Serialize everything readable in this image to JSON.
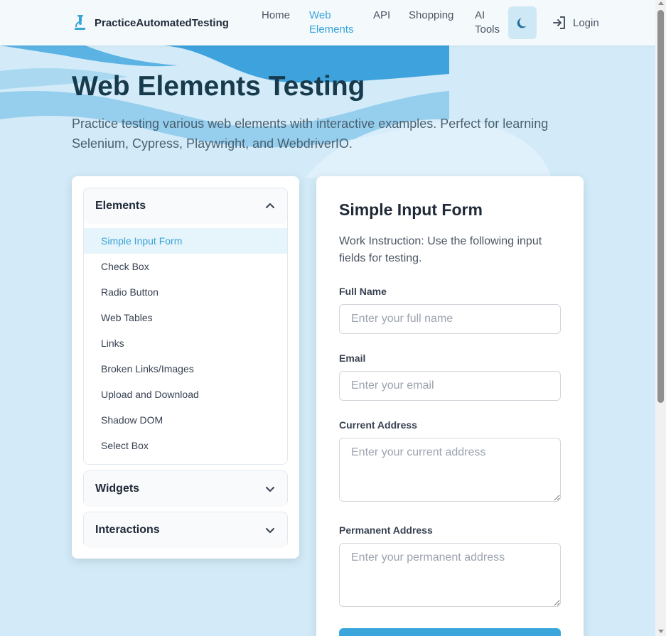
{
  "navbar": {
    "brand": "PracticeAutomatedTesting",
    "items": [
      {
        "label": "Home",
        "active": false
      },
      {
        "label": "Web\nElements",
        "active": true
      },
      {
        "label": "API",
        "active": false
      },
      {
        "label": "Shopping",
        "active": false
      },
      {
        "label": "AI\nTools",
        "active": false
      }
    ],
    "theme_icon": "moon-icon",
    "login_icon": "login-icon",
    "login_label": "Login"
  },
  "hero": {
    "title": "Web Elements Testing",
    "subtitle": "Practice testing various web elements with interactive examples. Perfect for learning Selenium, Cypress, Playwright, and WebdriverIO."
  },
  "sidebar": {
    "sections": [
      {
        "title": "Elements",
        "expanded": true,
        "icon": "chevron-up-icon",
        "items": [
          {
            "label": "Simple Input Form",
            "active": true
          },
          {
            "label": "Check Box",
            "active": false
          },
          {
            "label": "Radio Button",
            "active": false
          },
          {
            "label": "Web Tables",
            "active": false
          },
          {
            "label": "Links",
            "active": false
          },
          {
            "label": "Broken Links/Images",
            "active": false
          },
          {
            "label": "Upload and Download",
            "active": false
          },
          {
            "label": "Shadow DOM",
            "active": false
          },
          {
            "label": "Select Box",
            "active": false
          }
        ]
      },
      {
        "title": "Widgets",
        "expanded": false,
        "icon": "chevron-down-icon"
      },
      {
        "title": "Interactions",
        "expanded": false,
        "icon": "chevron-down-icon"
      }
    ]
  },
  "form": {
    "title": "Simple Input Form",
    "instruction": "Work Instruction: Use the following input fields for testing.",
    "fields": [
      {
        "label": "Full Name",
        "placeholder": "Enter your full name",
        "value": ""
      },
      {
        "label": "Email",
        "placeholder": "Enter your email",
        "value": ""
      },
      {
        "label": "Current Address",
        "placeholder": "Enter your current address",
        "value": ""
      },
      {
        "label": "Permanent Address",
        "placeholder": "Enter your permanent address",
        "value": ""
      }
    ]
  },
  "colors": {
    "accent": "#38a4d8",
    "background": "#d3ebf8",
    "title": "#173b4d"
  }
}
